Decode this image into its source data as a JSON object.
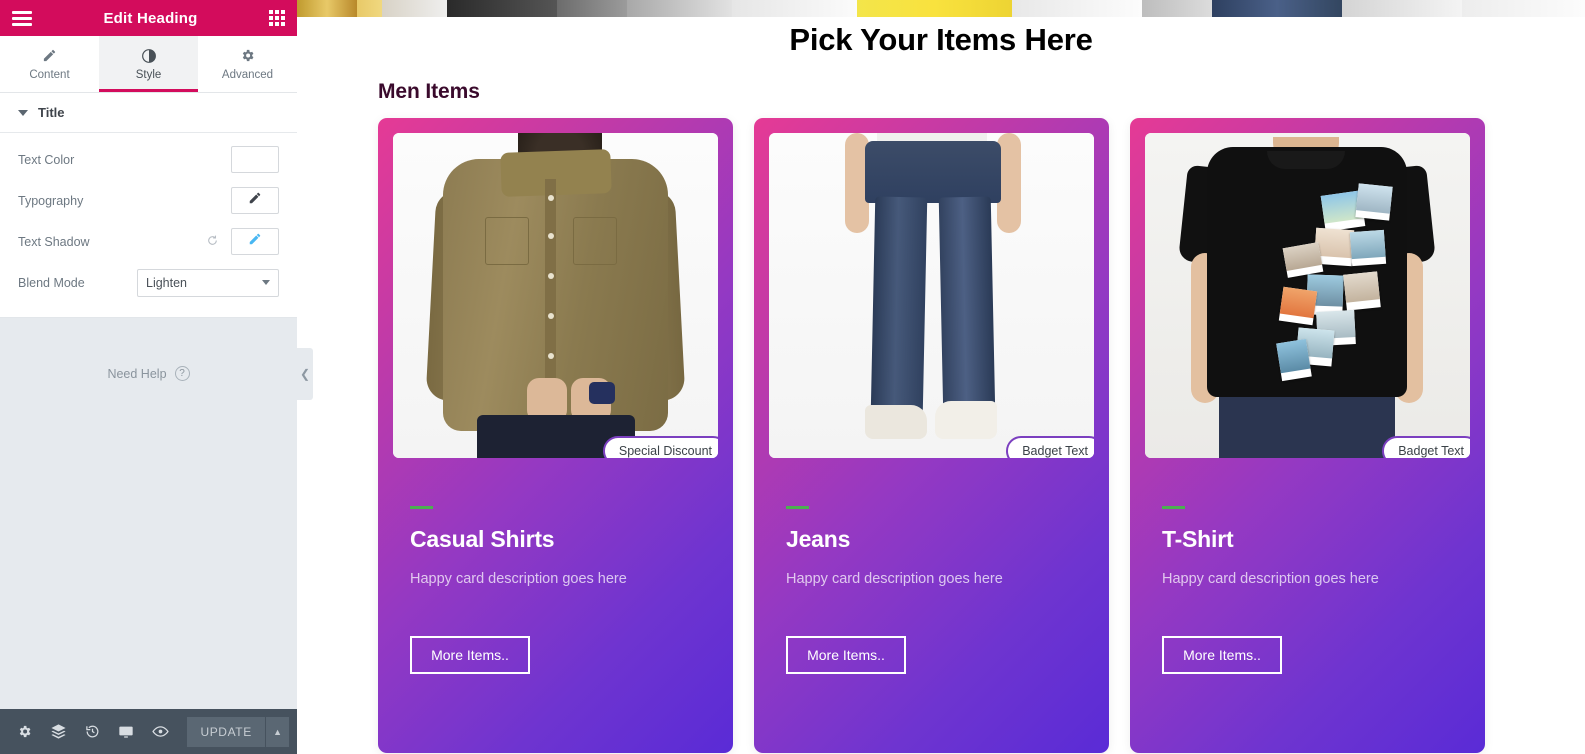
{
  "panel": {
    "header": {
      "title": "Edit Heading",
      "menu_icon": "hamburger-menu-icon",
      "apps_icon": "grid-apps-icon"
    },
    "tabs": [
      {
        "id": "content",
        "label": "Content",
        "icon": "pencil-icon",
        "active": false
      },
      {
        "id": "style",
        "label": "Style",
        "icon": "contrast-circle-icon",
        "active": true
      },
      {
        "id": "advanced",
        "label": "Advanced",
        "icon": "gear-icon",
        "active": false
      }
    ],
    "section": {
      "label": "Title",
      "collapsed": false
    },
    "controls": [
      {
        "id": "text_color",
        "label": "Text Color",
        "type": "color-swatch",
        "value": "#ffffff"
      },
      {
        "id": "typography",
        "label": "Typography",
        "type": "edit-button",
        "icon": "pencil-icon",
        "state": "default"
      },
      {
        "id": "text_shadow",
        "label": "Text Shadow",
        "type": "edit-button",
        "icon": "pencil-icon",
        "state": "modified",
        "reset_icon": "reset-icon"
      },
      {
        "id": "blend_mode",
        "label": "Blend Mode",
        "type": "select",
        "value": "Lighten"
      }
    ],
    "need_help": {
      "label": "Need Help",
      "icon": "question-mark-icon"
    },
    "collapse_handle": {
      "icon": "chevron-left-icon"
    },
    "footer": {
      "icons": [
        {
          "name": "settings-gear-icon",
          "glyph": "⚙"
        },
        {
          "name": "layers-navigator-icon",
          "glyph": "≣"
        },
        {
          "name": "history-clock-icon",
          "glyph": "↺"
        },
        {
          "name": "responsive-monitor-icon",
          "glyph": "▭"
        },
        {
          "name": "preview-eye-icon",
          "glyph": "◉"
        }
      ],
      "update_label": "UPDATE",
      "update_caret_icon": "chevron-up-icon"
    }
  },
  "canvas": {
    "main_heading": "Pick Your Items Here",
    "sub_heading": "Men Items",
    "cards": [
      {
        "id": "casual-shirts",
        "badge": "Special Discount",
        "title": "Casual Shirts",
        "description": "Happy card description goes here",
        "button": "More Items..",
        "image_alt": "man-wearing-khaki-casual-shirt"
      },
      {
        "id": "jeans",
        "badge": "Badget Text",
        "title": "Jeans",
        "description": "Happy card description goes here",
        "button": "More Items..",
        "image_alt": "man-wearing-blue-jeans-and-white-sneakers"
      },
      {
        "id": "t-shirt",
        "badge": "Badget Text",
        "title": "T-Shirt",
        "description": "Happy card description goes here",
        "button": "More Items..",
        "image_alt": "man-wearing-black-tshirt-with-photo-print"
      }
    ]
  },
  "colors": {
    "brand_pink": "#d30c5c",
    "card_gradient_start": "#e53a95",
    "card_gradient_end": "#5a2bd6",
    "accent_green": "#4caf50",
    "footer_bar": "#46525e",
    "panel_bg": "#e6eaee",
    "sub_heading_color": "#3a0a2c",
    "badge_border": "#7b3fbf"
  }
}
